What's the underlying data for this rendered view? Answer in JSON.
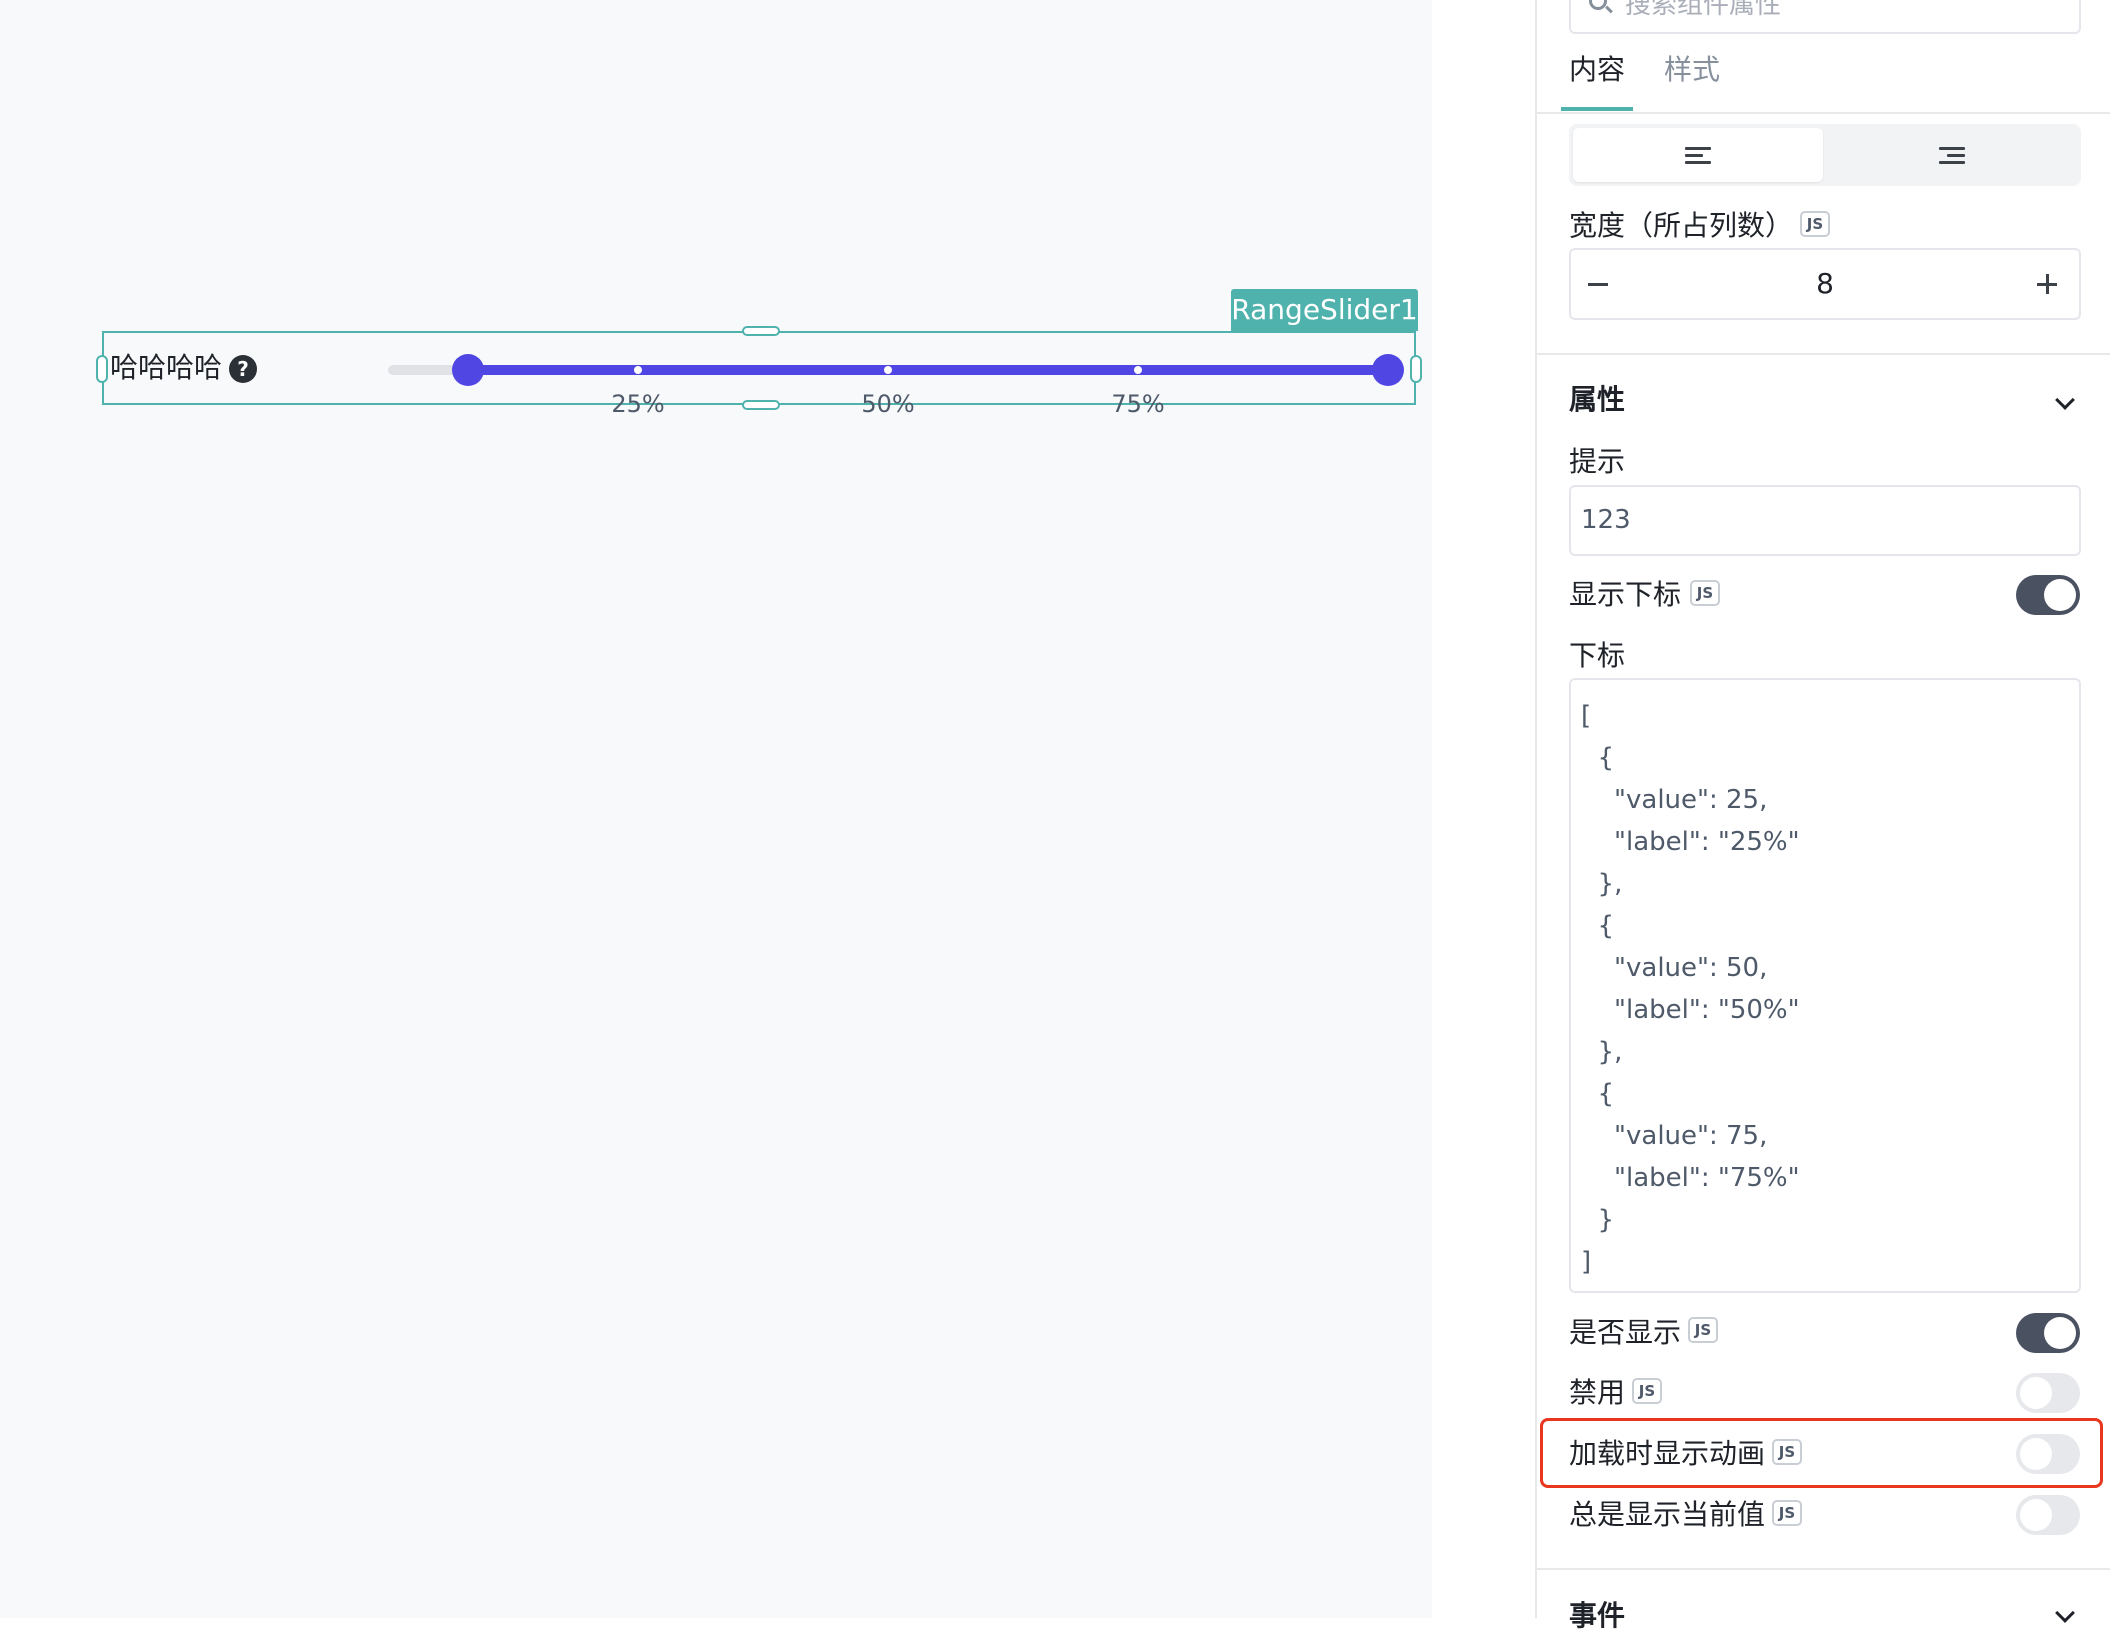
{
  "canvas": {
    "component_tag": "RangeSlider1",
    "field_label": "哈哈哈哈",
    "slider": {
      "min": 0,
      "max": 100,
      "value_start": 8,
      "value_end": 100,
      "marks": [
        {
          "value": 25,
          "label": "25%"
        },
        {
          "value": 50,
          "label": "50%"
        },
        {
          "value": 75,
          "label": "75%"
        }
      ]
    },
    "colors": {
      "accent": "#5046e4",
      "selection": "#4fb2ad"
    }
  },
  "panel": {
    "search_placeholder": "搜索组件属性",
    "tabs": [
      {
        "label": "内容",
        "active": true
      },
      {
        "label": "样式",
        "active": false
      }
    ],
    "width_label": "宽度（所占列数）",
    "js_badge": "JS",
    "width_value": "8",
    "section_properties": "属性",
    "tooltip_label": "提示",
    "tooltip_value": "123",
    "show_marks_label": "显示下标",
    "show_marks": true,
    "marks_label": "下标",
    "marks_json": [
      "[",
      "  {",
      "    \"value\": 25,",
      "    \"label\": \"25%\"",
      "  },",
      "  {",
      "    \"value\": 50,",
      "    \"label\": \"50%\"",
      "  },",
      "  {",
      "    \"value\": 75,",
      "    \"label\": \"75%\"",
      "  }",
      "]"
    ],
    "visible_label": "是否显示",
    "visible": true,
    "disabled_label": "禁用",
    "disabled": false,
    "loading_anim_label": "加载时显示动画",
    "loading_anim": false,
    "always_show_value_label": "总是显示当前值",
    "always_show_value": false,
    "section_events": "事件",
    "highlight_color": "#e8361f"
  }
}
